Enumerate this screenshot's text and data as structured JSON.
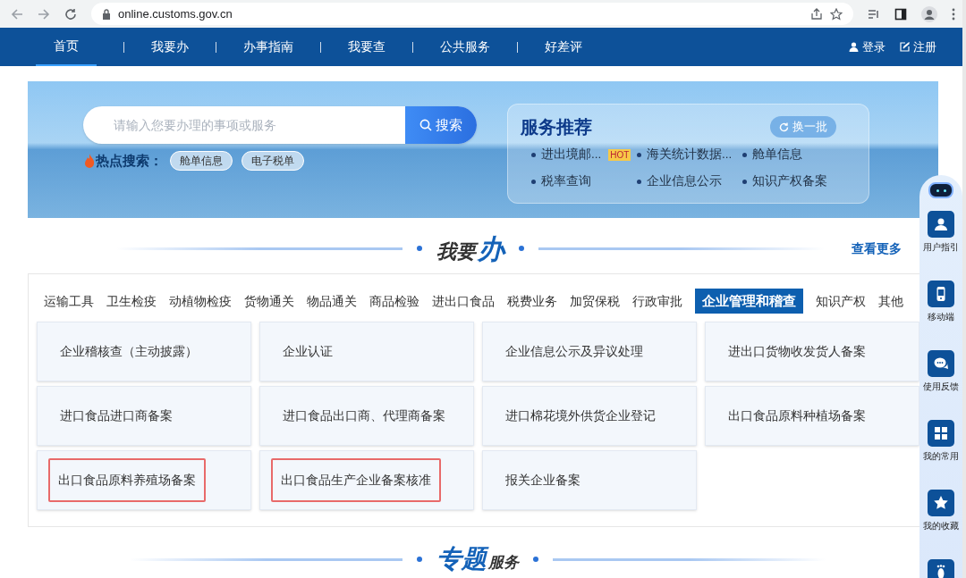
{
  "browser": {
    "url": "online.customs.gov.cn"
  },
  "nav": {
    "items": [
      {
        "label": "首页",
        "selected": true
      },
      {
        "label": "我要办",
        "selected": false
      },
      {
        "label": "办事指南",
        "selected": false
      },
      {
        "label": "我要查",
        "selected": false
      },
      {
        "label": "公共服务",
        "selected": false
      },
      {
        "label": "好差评",
        "selected": false
      }
    ],
    "login": "登录",
    "register": "注册"
  },
  "banner": {
    "search": {
      "placeholder": "请输入您要办理的事项或服务",
      "button": "搜索"
    },
    "hot_label": "热点搜索：",
    "hot_tags": [
      "舱单信息",
      "电子税单"
    ],
    "recommend": {
      "title": "服务推荐",
      "refresh": "换一批",
      "items": [
        {
          "label": "进出境邮...",
          "badge": "HOT"
        },
        {
          "label": "海关统计数据..."
        },
        {
          "label": "舱单信息"
        },
        {
          "label": "税率查询"
        },
        {
          "label": "企业信息公示"
        },
        {
          "label": "知识产权备案"
        }
      ]
    }
  },
  "section": {
    "title_a": "我要",
    "title_b": "办",
    "more": "查看更多"
  },
  "categories": [
    {
      "label": "运输工具",
      "selected": false
    },
    {
      "label": "卫生检疫",
      "selected": false
    },
    {
      "label": "动植物检疫",
      "selected": false
    },
    {
      "label": "货物通关",
      "selected": false
    },
    {
      "label": "物品通关",
      "selected": false
    },
    {
      "label": "商品检验",
      "selected": false
    },
    {
      "label": "进出口食品",
      "selected": false
    },
    {
      "label": "税费业务",
      "selected": false
    },
    {
      "label": "加贸保税",
      "selected": false
    },
    {
      "label": "行政审批",
      "selected": false
    },
    {
      "label": "企业管理和稽查",
      "selected": true
    },
    {
      "label": "知识产权",
      "selected": false
    },
    {
      "label": "其他",
      "selected": false
    }
  ],
  "services": [
    {
      "label": "企业稽核查（主动披露）",
      "highlighted": false
    },
    {
      "label": "企业认证",
      "highlighted": false
    },
    {
      "label": "企业信息公示及异议处理",
      "highlighted": false
    },
    {
      "label": "进出口货物收发货人备案",
      "highlighted": false
    },
    {
      "label": "进口食品进口商备案",
      "highlighted": false
    },
    {
      "label": "进口食品出口商、代理商备案",
      "highlighted": false
    },
    {
      "label": "进口棉花境外供货企业登记",
      "highlighted": false
    },
    {
      "label": "出口食品原料种植场备案",
      "highlighted": false
    },
    {
      "label": "出口食品原料养殖场备案",
      "highlighted": true
    },
    {
      "label": "出口食品生产企业备案核准",
      "highlighted": true
    },
    {
      "label": "报关企业备案",
      "highlighted": false
    }
  ],
  "section2": {
    "title_a": "专题",
    "title_b": "服务"
  },
  "sidebar": [
    {
      "kind": "user",
      "label": "用户指引"
    },
    {
      "kind": "mobile",
      "label": "移动端"
    },
    {
      "kind": "feedback",
      "label": "使用反馈"
    },
    {
      "kind": "grid",
      "label": "我的常用"
    },
    {
      "kind": "star",
      "label": "我的收藏"
    },
    {
      "kind": "foot"
    }
  ]
}
